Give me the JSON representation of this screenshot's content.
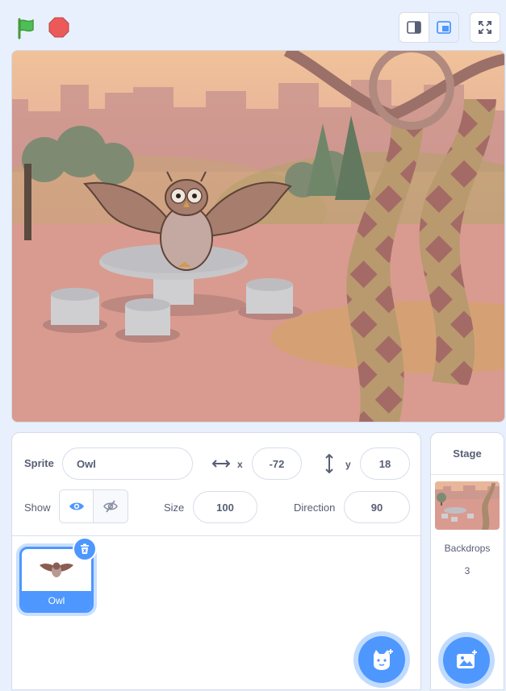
{
  "controls": {
    "green_flag_icon": "green-flag-icon",
    "stop_icon": "stop-icon"
  },
  "view_modes": [
    "small-stage-icon",
    "large-stage-icon",
    "fullscreen-icon"
  ],
  "sprite_info": {
    "sprite_label": "Sprite",
    "sprite_name": "Owl",
    "x_label": "x",
    "x_value": "-72",
    "y_label": "y",
    "y_value": "18",
    "show_label": "Show",
    "size_label": "Size",
    "size_value": "100",
    "direction_label": "Direction",
    "direction_value": "90"
  },
  "sprites": [
    {
      "name": "Owl",
      "selected": true
    }
  ],
  "stage_panel": {
    "title": "Stage",
    "backdrops_label": "Backdrops",
    "backdrops_count": "3"
  },
  "colors": {
    "accent": "#4d97ff",
    "stage_bg": "#d99b90"
  }
}
